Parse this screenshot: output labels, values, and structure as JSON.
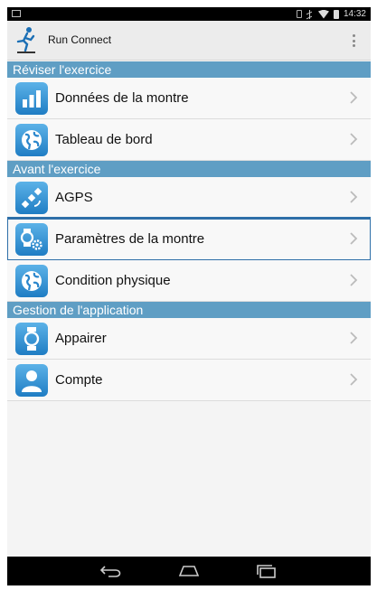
{
  "status_bar": {
    "time": "14:32"
  },
  "app": {
    "title": "Run Connect"
  },
  "sections": [
    {
      "header": "Réviser l'exercice",
      "items": [
        {
          "label": "Données de la montre",
          "icon": "bar-chart-icon"
        },
        {
          "label": "Tableau de bord",
          "icon": "globe-icon"
        }
      ]
    },
    {
      "header": "Avant l'exercice",
      "items": [
        {
          "label": "AGPS",
          "icon": "satellite-icon"
        },
        {
          "label": "Paramètres de la montre",
          "icon": "watch-settings-icon"
        },
        {
          "label": "Condition physique",
          "icon": "globe-icon"
        }
      ]
    },
    {
      "header": "Gestion de l'application",
      "items": [
        {
          "label": "Appairer",
          "icon": "watch-icon"
        },
        {
          "label": "Compte",
          "icon": "user-icon"
        }
      ]
    }
  ],
  "colors": {
    "section_header": "#5f9ec4",
    "icon_blue": "#1f7dc4",
    "highlight_border": "#2e6fa8"
  }
}
